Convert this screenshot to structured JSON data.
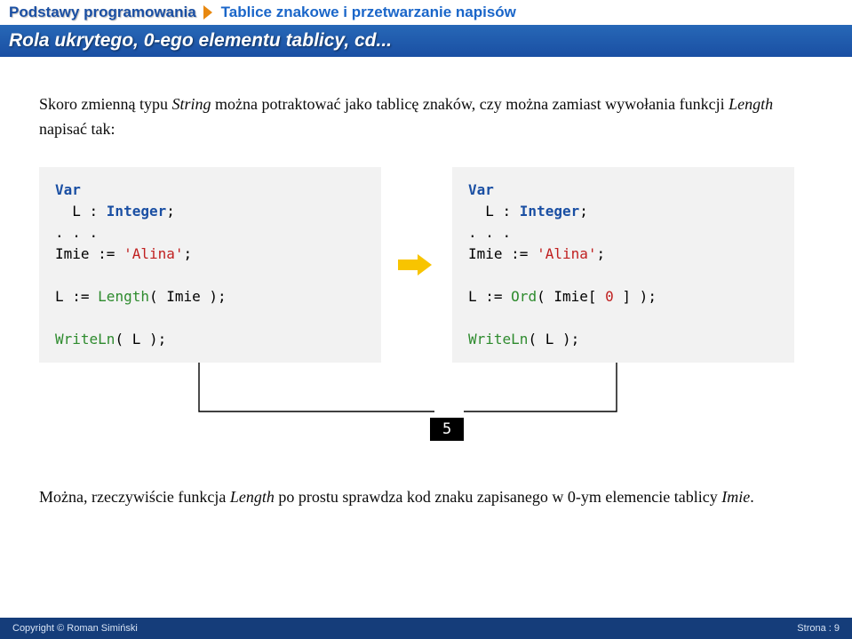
{
  "header": {
    "left": "Podstawy programowania",
    "right": "Tablice znakowe i przetwarzanie napisów"
  },
  "subheader": "Rola ukrytego, 0-ego elementu tablicy, cd...",
  "intro": {
    "before_string": "Skoro zmienną typu ",
    "string_word": "String",
    "after_string": " można potraktować jako tablicę znaków, czy można zamiast wywołania funkcji ",
    "length_word": "Length",
    "tail": " napisać tak:"
  },
  "code_left": {
    "l1a": "Var",
    "l2a": "  L : ",
    "l2b": "Integer",
    "l2c": ";",
    "l3": ". . .",
    "l4a": "Imie := ",
    "l4b": "'Alina'",
    "l4c": ";",
    "blank": "",
    "l5a": "L := ",
    "l5b": "Length",
    "l5c": "( Imie );",
    "l6a": "WriteLn",
    "l6b": "( L );"
  },
  "code_right": {
    "l1a": "Var",
    "l2a": "  L : ",
    "l2b": "Integer",
    "l2c": ";",
    "l3": ". . .",
    "l4a": "Imie := ",
    "l4b": "'Alina'",
    "l4c": ";",
    "blank": "",
    "l5a": "L := ",
    "l5b": "Ord",
    "l5c": "( Imie[ ",
    "l5d": "0",
    "l5e": " ] );",
    "l6a": "WriteLn",
    "l6b": "( L );"
  },
  "result": "5",
  "conclusion": {
    "before_length": "Można, rzeczywiście funkcja ",
    "length_word": "Length",
    "mid": " po prostu sprawdza kod znaku zapisanego w 0-ym elemencie tablicy ",
    "imie_word": "Imie",
    "tail": "."
  },
  "footer": {
    "left": "Copyright © Roman Simiński",
    "right": "Strona :  9"
  }
}
